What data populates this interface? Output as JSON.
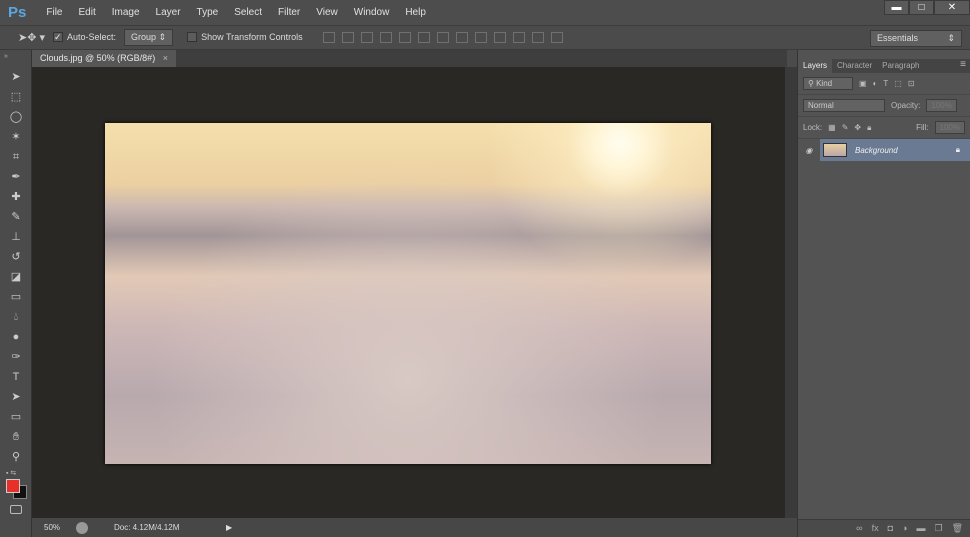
{
  "app": {
    "logo": "Ps"
  },
  "menu": [
    "File",
    "Edit",
    "Image",
    "Layer",
    "Type",
    "Select",
    "Filter",
    "View",
    "Window",
    "Help"
  ],
  "window_controls": {
    "minimize": "▬",
    "maximize": "□",
    "close": "✕"
  },
  "options": {
    "auto_select_label": "Auto-Select:",
    "auto_select_checked": "✓",
    "auto_select_target": "Group",
    "show_transform_label": "Show Transform Controls",
    "workspace": "Essentials"
  },
  "document_tab": {
    "title": "Clouds.jpg @ 50% (RGB/8#)",
    "close": "×"
  },
  "tools": [
    "move",
    "marquee",
    "lasso",
    "magic-wand",
    "crop",
    "eyedropper",
    "healing-brush",
    "brush",
    "clone-stamp",
    "history-brush",
    "eraser",
    "gradient",
    "blur",
    "dodge",
    "pen",
    "type",
    "path-selection",
    "rectangle",
    "hand",
    "zoom"
  ],
  "colors": {
    "foreground": "#e8302a",
    "background": "#111111"
  },
  "status": {
    "zoom": "50%",
    "doc": "Doc: 4.12M/4.12M"
  },
  "layers_panel": {
    "tabs": [
      "Layers",
      "Character",
      "Paragraph"
    ],
    "filter": "Kind",
    "blend_mode": "Normal",
    "opacity_label": "Opacity:",
    "opacity": "100%",
    "lock_label": "Lock:",
    "fill_label": "Fill:",
    "fill": "100%",
    "layers": [
      {
        "name": "Background",
        "visible": true,
        "locked": true
      }
    ]
  }
}
